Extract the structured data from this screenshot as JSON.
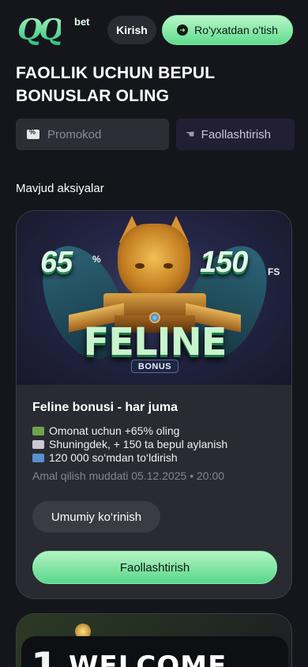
{
  "header": {
    "logo_text": "QQ",
    "logo_suffix": "bet",
    "login_label": "Kirish",
    "register_label": "Ro'yxatdan o'tish"
  },
  "page_title": "FAOLLIK UCHUN BEPUL BONUSLAR OLING",
  "promo": {
    "placeholder": "Promokod",
    "activate_label": "Faollashtirish"
  },
  "section_label": "Mavjud aksiyalar",
  "promotions": [
    {
      "banner": {
        "left_value": "65",
        "left_suffix": "%",
        "right_value": "150",
        "right_suffix": "FS",
        "headline": "FELINE",
        "badge": "BONUS"
      },
      "title": "Feline bonusi - har juma",
      "perks": [
        {
          "icon": "money-icon",
          "text": "Omonat uchun +65% oling"
        },
        {
          "icon": "slot-machine-icon",
          "text": "Shuningdek, + 150 ta bepul aylanish"
        },
        {
          "icon": "card-icon",
          "text": "120 000 so‘mdan to‘ldirish"
        }
      ],
      "validity": "Amal qilish muddati 05.12.2025 • 20:00",
      "overview_label": "Umumiy ko‘rinish",
      "activate_label": "Faollashtirish"
    },
    {
      "banner": {
        "number": "1",
        "headline": "WELCOME"
      }
    }
  ],
  "colors": {
    "background": "#15161c",
    "accent_green": "#5fdc8d",
    "card": "#2a2b32"
  }
}
